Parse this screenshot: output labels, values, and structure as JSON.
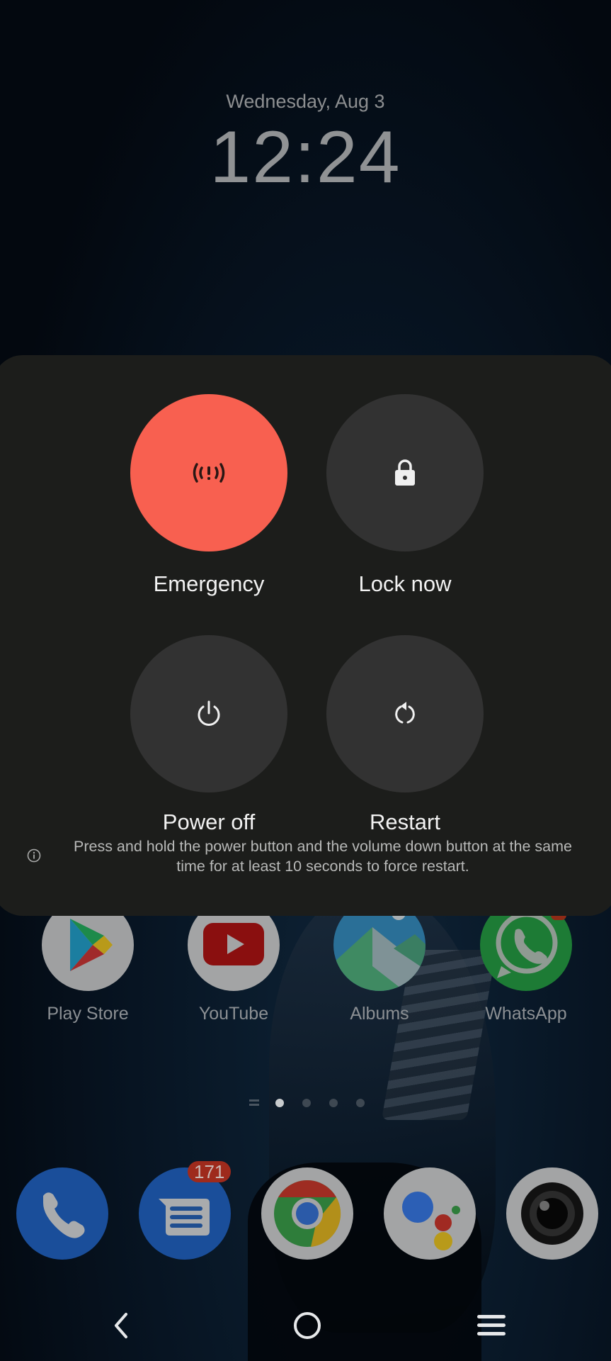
{
  "lockscreen": {
    "date": "Wednesday, Aug 3",
    "time": "12:24"
  },
  "power_menu": {
    "actions": [
      {
        "id": "emergency",
        "label": "Emergency",
        "icon": "emergency-broadcast-icon",
        "color": "#f86050"
      },
      {
        "id": "lock",
        "label": "Lock now",
        "icon": "lock-icon",
        "color": "#323232"
      },
      {
        "id": "power-off",
        "label": "Power off",
        "icon": "power-icon",
        "color": "#323232"
      },
      {
        "id": "restart",
        "label": "Restart",
        "icon": "restart-icon",
        "color": "#323232"
      }
    ],
    "hint": {
      "icon": "info-icon",
      "text": "Press and hold the power button and the volume down button at the same time for at least 10 seconds to force restart."
    }
  },
  "home_apps": [
    {
      "name": "Play Store",
      "icon": "play-store-icon"
    },
    {
      "name": "YouTube",
      "icon": "youtube-icon"
    },
    {
      "name": "Albums",
      "icon": "albums-icon"
    },
    {
      "name": "WhatsApp",
      "icon": "whatsapp-icon",
      "has_badge": true
    }
  ],
  "page_indicator": {
    "pages": 4,
    "current": 1
  },
  "dock": [
    {
      "name": "Phone",
      "icon": "phone-icon"
    },
    {
      "name": "Messages",
      "icon": "messages-icon",
      "badge": "171"
    },
    {
      "name": "Chrome",
      "icon": "chrome-icon"
    },
    {
      "name": "Assistant",
      "icon": "assistant-icon"
    },
    {
      "name": "Camera",
      "icon": "camera-icon"
    }
  ],
  "navbar": {
    "back": "back-icon",
    "home": "home-icon",
    "menu": "menu-icon"
  },
  "colors": {
    "panel": "#1c1d1b",
    "emergency": "#f86050",
    "action_circle": "#323232",
    "badge": "#9e2a1c"
  }
}
